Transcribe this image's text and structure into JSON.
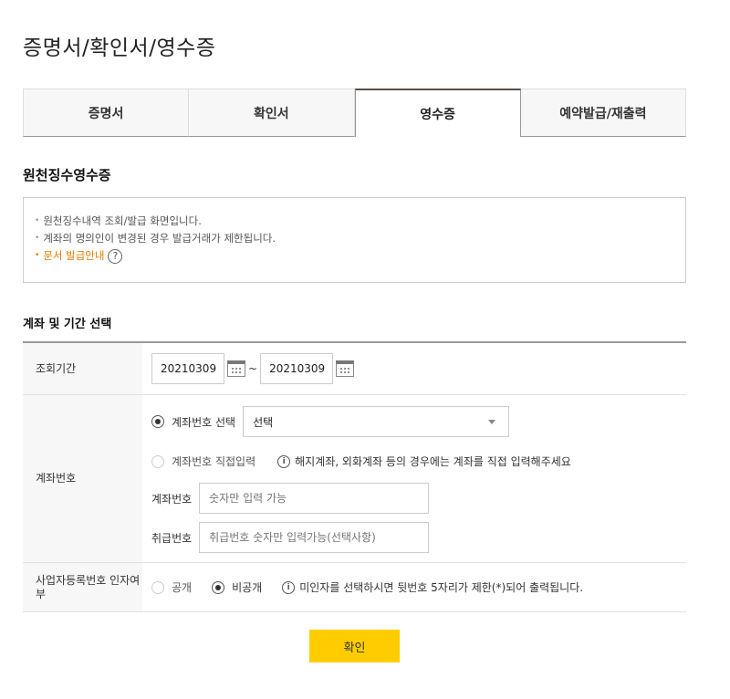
{
  "page_title": "증명서/확인서/영수증",
  "tabs": [
    {
      "label": "증명서",
      "active": false
    },
    {
      "label": "확인서",
      "active": false
    },
    {
      "label": "영수증",
      "active": true
    },
    {
      "label": "예약발급/재출력",
      "active": false
    }
  ],
  "section_title": "원천징수영수증",
  "notices": [
    "원천징수내역 조회/발급 화면입니다.",
    "계좌의 명의인이 변경된 경우 발급거래가 제한됩니다."
  ],
  "doc_guide_link": "문서 발급안내",
  "help_glyph": "?",
  "sub_title": "계좌 및 기간 선택",
  "form": {
    "period": {
      "label": "조회기간",
      "start": "20210309",
      "end": "20210309",
      "separator": "~"
    },
    "account": {
      "label": "계좌번호",
      "option_select_label": "계좌번호 선택",
      "option_select_checked": true,
      "select_value": "선택",
      "option_direct_label": "계좌번호 직접입력",
      "option_direct_checked": false,
      "direct_info": "해지계좌, 외화계좌 등의 경우에는 계좌를 직접 입력해주세요",
      "account_no_label": "계좌번호",
      "account_no_placeholder": "숫자만 입력 가능",
      "handling_no_label": "취급번호",
      "handling_no_placeholder": "취급번호 숫자만 입력가능(선택사항)"
    },
    "biz_reg": {
      "label": "사업자등록번호 인자여부",
      "option_public": "공개",
      "option_public_checked": false,
      "option_private": "비공개",
      "option_private_checked": true,
      "info": "미인자를 선택하시면 뒷번호 5자리가 제한(*)되어 출력됩니다."
    }
  },
  "info_glyph": "i",
  "confirm_label": "확인",
  "colors": {
    "accent_yellow": "#ffcc00",
    "link_orange": "#e07b00",
    "active_tab_border": "#5c4f45"
  }
}
